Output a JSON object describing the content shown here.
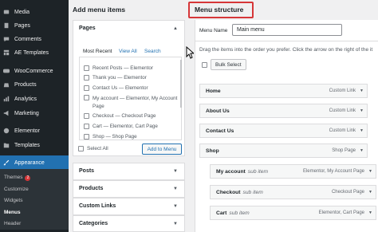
{
  "sidebar": {
    "items": [
      {
        "label": "Media",
        "icon": "media-icon"
      },
      {
        "label": "Pages",
        "icon": "pages-icon"
      },
      {
        "label": "Comments",
        "icon": "comments-icon"
      },
      {
        "label": "AE Templates",
        "icon": "templates-icon"
      },
      {
        "label": "WooCommerce",
        "icon": "woocommerce-icon"
      },
      {
        "label": "Products",
        "icon": "products-icon"
      },
      {
        "label": "Analytics",
        "icon": "analytics-icon"
      },
      {
        "label": "Marketing",
        "icon": "marketing-icon"
      },
      {
        "label": "Elementor",
        "icon": "elementor-icon"
      },
      {
        "label": "Templates",
        "icon": "folder-icon"
      },
      {
        "label": "Appearance",
        "icon": "appearance-icon"
      }
    ],
    "submenu": [
      {
        "label": "Themes",
        "badge": "2"
      },
      {
        "label": "Customize"
      },
      {
        "label": "Widgets"
      },
      {
        "label": "Menus"
      },
      {
        "label": "Header"
      }
    ]
  },
  "add_items": {
    "title": "Add menu items",
    "pages_section": {
      "title": "Pages",
      "tabs": [
        "Most Recent",
        "View All",
        "Search"
      ],
      "items": [
        "Recent Posts — Elementor",
        "Thank you — Elementor",
        "Contact Us — Elementor",
        "My account — Elementor, My Account Page",
        "Checkout — Checkout Page",
        "Cart — Elementor, Cart Page",
        "Shop — Shop Page"
      ],
      "select_all": "Select All",
      "add_button": "Add to Menu"
    },
    "sections": [
      "Posts",
      "Products",
      "Custom Links",
      "Categories"
    ]
  },
  "structure": {
    "title": "Menu structure",
    "menu_name_label": "Menu Name",
    "menu_name_value": "Main menu",
    "instructions": "Drag the items into the order you prefer. Click the arrow on the right of the it",
    "bulk_select": "Bulk Select",
    "items": [
      {
        "title": "Home",
        "sub": "",
        "type": "Custom Link"
      },
      {
        "title": "About Us",
        "sub": "",
        "type": "Custom Link"
      },
      {
        "title": "Contact Us",
        "sub": "",
        "type": "Custom Link"
      },
      {
        "title": "Shop",
        "sub": "",
        "type": "Shop Page"
      },
      {
        "title": "My account",
        "sub": "sub item",
        "type": "Elementor, My Account Page"
      },
      {
        "title": "Checkout",
        "sub": "sub item",
        "type": "Checkout Page"
      },
      {
        "title": "Cart",
        "sub": "sub item",
        "type": "Elementor, Cart Page"
      }
    ]
  },
  "colors": {
    "sidebar_bg": "#1d2327",
    "active_blue": "#2271b1",
    "highlight_red": "#d63638"
  }
}
